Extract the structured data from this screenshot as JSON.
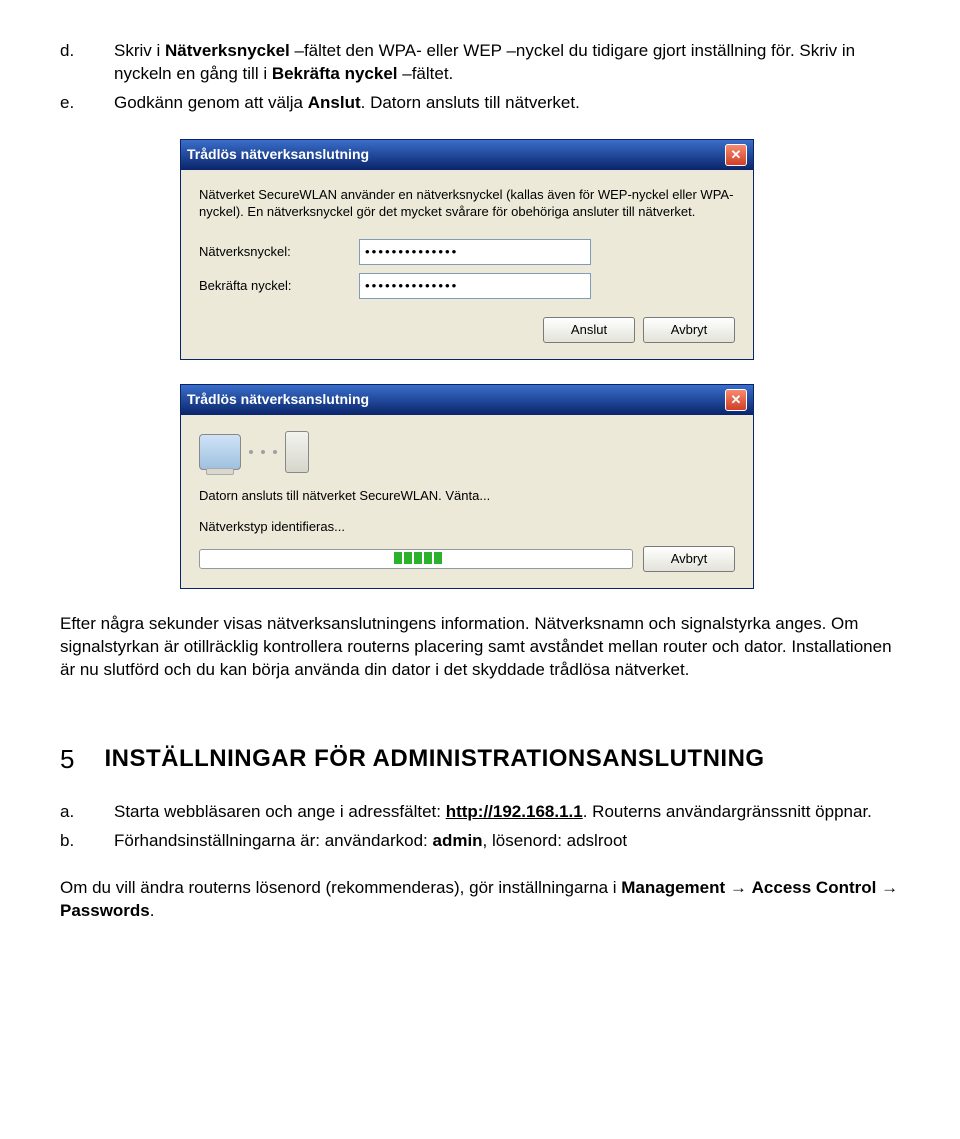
{
  "steps": {
    "d": {
      "marker": "d.",
      "t1a": "Skriv i ",
      "t1b": "Nätverksnyckel",
      "t1c": " –fältet den WPA- eller WEP –nyckel du tidigare gjort inställning för. Skriv in nyckeln en gång till i ",
      "t1d": "Bekräfta nyckel",
      "t1e": " –fältet."
    },
    "e": {
      "marker": "e.",
      "t1a": "Godkänn genom att välja ",
      "t1b": "Anslut",
      "t1c": ". Datorn ansluts till nätverket."
    }
  },
  "dialog1": {
    "title": "Trådlös nätverksanslutning",
    "body": "Nätverket SecureWLAN använder en nätverksnyckel (kallas även för WEP-nyckel eller WPA-nyckel). En nätverksnyckel gör det mycket svårare för obehöriga ansluter till nätverket.",
    "label1": "Nätverksnyckel:",
    "label2": "Bekräfta nyckel:",
    "pwd": "••••••••••••••",
    "btn_connect": "Anslut",
    "btn_cancel": "Avbryt"
  },
  "dialog2": {
    "title": "Trådlös nätverksanslutning",
    "line1": "Datorn ansluts till nätverket SecureWLAN. Vänta...",
    "line2": "Nätverkstyp identifieras...",
    "btn_cancel": "Avbryt"
  },
  "after_para": "Efter några sekunder visas nätverksanslutningens information. Nätverksnamn och signalstyrka anges. Om signalstyrkan är otillräcklig kontrollera routerns placering samt avståndet mellan router och dator. Installationen är nu slutförd och du kan börja använda din dator i det skyddade trådlösa nätverket.",
  "section5": {
    "num": "5",
    "title": "INSTÄLLNINGAR FÖR ADMINISTRATIONSANSLUTNING",
    "a": {
      "marker": "a.",
      "t1": "Starta webbläsaren och ange i adressfältet: ",
      "addr": "http://192.168.1.1",
      "t2": ". Routerns användargränssnitt öppnar."
    },
    "b": {
      "marker": "b.",
      "t1": "Förhandsinställningarna är: användarkod: ",
      "admin": "admin",
      "t2": ", lösenord: adslroot"
    },
    "bottom": {
      "t1": "Om du vill ändra routerns lösenord (rekommenderas), gör inställningarna i ",
      "b1": "Management",
      "arrow1": " → ",
      "b2": "Access Control",
      "arrow2": " → ",
      "b3": "Passwords",
      "t2": "."
    }
  }
}
